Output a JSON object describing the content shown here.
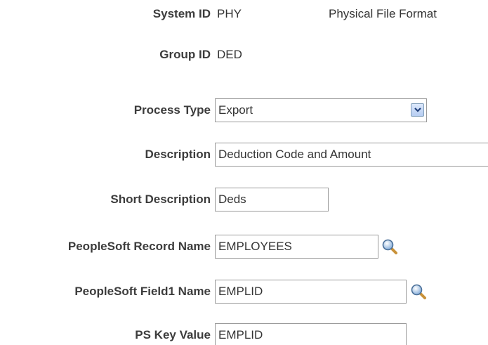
{
  "system_id": {
    "label": "System ID",
    "value": "PHY",
    "description": "Physical File Format"
  },
  "group_id": {
    "label": "Group ID",
    "value": "DED"
  },
  "process_type": {
    "label": "Process Type",
    "value": "Export"
  },
  "description": {
    "label": "Description",
    "value": "Deduction Code and Amount"
  },
  "short_description": {
    "label": "Short Description",
    "value": "Deds"
  },
  "record_name": {
    "label": "PeopleSoft Record Name",
    "value": "EMPLOYEES"
  },
  "field1_name": {
    "label": "PeopleSoft Field1 Name",
    "value": "EMPLID"
  },
  "ps_key_value": {
    "label": "PS Key Value",
    "value": "EMPLID"
  },
  "icons": {
    "dropdown": "chevron-down-icon",
    "lookup": "magnifier-icon"
  },
  "colors": {
    "field_border": "#9a9a9a",
    "dropdown_button": "#b6cdf2",
    "label_text": "#3c3c3c"
  }
}
